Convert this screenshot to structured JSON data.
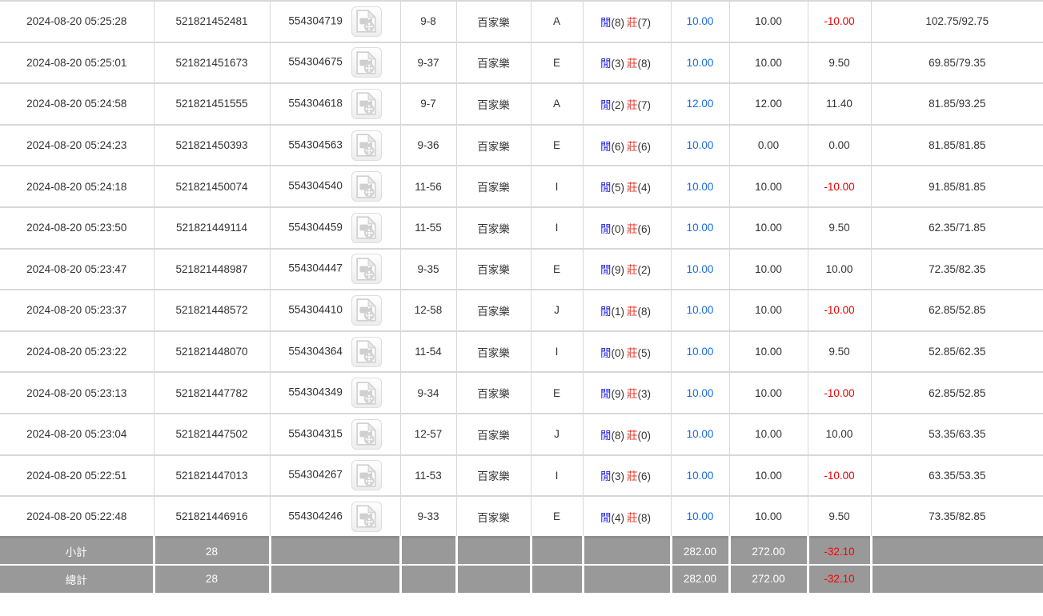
{
  "table": {
    "result_labels": {
      "player": "閒",
      "banker": "莊"
    },
    "icon_name": "video-file-icon",
    "colors": {
      "bet_amount_blue": "#1b6ce0",
      "loss_red": "#ee0000",
      "player_blue": "#2323e8",
      "banker_red": "#e8392c",
      "footer_bg": "#999999",
      "grid_border": "#d8d8d8"
    },
    "rows": [
      {
        "time": "2024-08-20 05:25:28",
        "bet_id": "521821452481",
        "round_id": "554304719",
        "table_round": "9-8",
        "game": "百家樂",
        "table_code": "A",
        "player": 8,
        "banker": 7,
        "bet": "10.00",
        "valid": "10.00",
        "win": "-10.00",
        "balance": "102.75/92.75"
      },
      {
        "time": "2024-08-20 05:25:01",
        "bet_id": "521821451673",
        "round_id": "554304675",
        "table_round": "9-37",
        "game": "百家樂",
        "table_code": "E",
        "player": 3,
        "banker": 8,
        "bet": "10.00",
        "valid": "10.00",
        "win": "9.50",
        "balance": "69.85/79.35"
      },
      {
        "time": "2024-08-20 05:24:58",
        "bet_id": "521821451555",
        "round_id": "554304618",
        "table_round": "9-7",
        "game": "百家樂",
        "table_code": "A",
        "player": 2,
        "banker": 7,
        "bet": "12.00",
        "valid": "12.00",
        "win": "11.40",
        "balance": "81.85/93.25"
      },
      {
        "time": "2024-08-20 05:24:23",
        "bet_id": "521821450393",
        "round_id": "554304563",
        "table_round": "9-36",
        "game": "百家樂",
        "table_code": "E",
        "player": 6,
        "banker": 6,
        "bet": "10.00",
        "valid": "0.00",
        "win": "0.00",
        "balance": "81.85/81.85"
      },
      {
        "time": "2024-08-20 05:24:18",
        "bet_id": "521821450074",
        "round_id": "554304540",
        "table_round": "11-56",
        "game": "百家樂",
        "table_code": "I",
        "player": 5,
        "banker": 4,
        "bet": "10.00",
        "valid": "10.00",
        "win": "-10.00",
        "balance": "91.85/81.85"
      },
      {
        "time": "2024-08-20 05:23:50",
        "bet_id": "521821449114",
        "round_id": "554304459",
        "table_round": "11-55",
        "game": "百家樂",
        "table_code": "I",
        "player": 0,
        "banker": 6,
        "bet": "10.00",
        "valid": "10.00",
        "win": "9.50",
        "balance": "62.35/71.85"
      },
      {
        "time": "2024-08-20 05:23:47",
        "bet_id": "521821448987",
        "round_id": "554304447",
        "table_round": "9-35",
        "game": "百家樂",
        "table_code": "E",
        "player": 9,
        "banker": 2,
        "bet": "10.00",
        "valid": "10.00",
        "win": "10.00",
        "balance": "72.35/82.35"
      },
      {
        "time": "2024-08-20 05:23:37",
        "bet_id": "521821448572",
        "round_id": "554304410",
        "table_round": "12-58",
        "game": "百家樂",
        "table_code": "J",
        "player": 1,
        "banker": 8,
        "bet": "10.00",
        "valid": "10.00",
        "win": "-10.00",
        "balance": "62.85/52.85"
      },
      {
        "time": "2024-08-20 05:23:22",
        "bet_id": "521821448070",
        "round_id": "554304364",
        "table_round": "11-54",
        "game": "百家樂",
        "table_code": "I",
        "player": 0,
        "banker": 5,
        "bet": "10.00",
        "valid": "10.00",
        "win": "9.50",
        "balance": "52.85/62.35"
      },
      {
        "time": "2024-08-20 05:23:13",
        "bet_id": "521821447782",
        "round_id": "554304349",
        "table_round": "9-34",
        "game": "百家樂",
        "table_code": "E",
        "player": 9,
        "banker": 3,
        "bet": "10.00",
        "valid": "10.00",
        "win": "-10.00",
        "balance": "62.85/52.85"
      },
      {
        "time": "2024-08-20 05:23:04",
        "bet_id": "521821447502",
        "round_id": "554304315",
        "table_round": "12-57",
        "game": "百家樂",
        "table_code": "J",
        "player": 8,
        "banker": 0,
        "bet": "10.00",
        "valid": "10.00",
        "win": "10.00",
        "balance": "53.35/63.35"
      },
      {
        "time": "2024-08-20 05:22:51",
        "bet_id": "521821447013",
        "round_id": "554304267",
        "table_round": "11-53",
        "game": "百家樂",
        "table_code": "I",
        "player": 3,
        "banker": 6,
        "bet": "10.00",
        "valid": "10.00",
        "win": "-10.00",
        "balance": "63.35/53.35"
      },
      {
        "time": "2024-08-20 05:22:48",
        "bet_id": "521821446916",
        "round_id": "554304246",
        "table_round": "9-33",
        "game": "百家樂",
        "table_code": "E",
        "player": 4,
        "banker": 8,
        "bet": "10.00",
        "valid": "10.00",
        "win": "9.50",
        "balance": "73.35/82.85"
      }
    ],
    "footer": [
      {
        "label": "小計",
        "count": "28",
        "bet": "282.00",
        "valid": "272.00",
        "win": "-32.10"
      },
      {
        "label": "總計",
        "count": "28",
        "bet": "282.00",
        "valid": "272.00",
        "win": "-32.10"
      }
    ]
  }
}
